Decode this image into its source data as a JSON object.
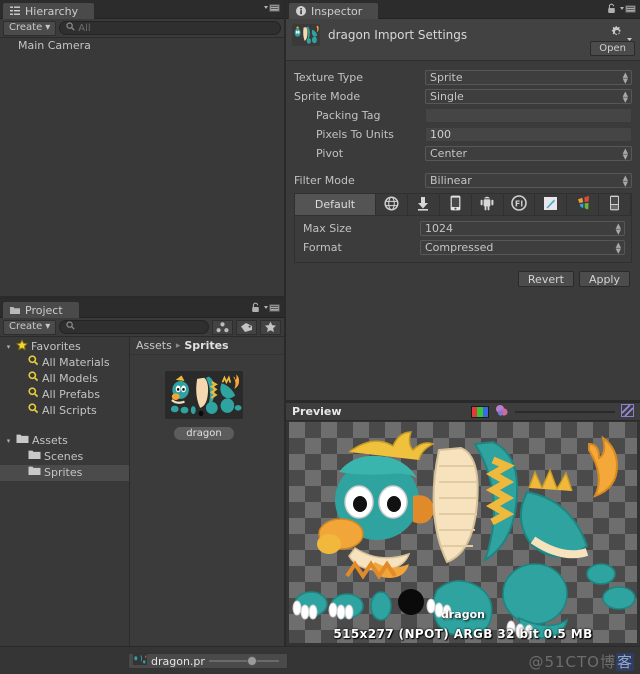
{
  "hierarchy": {
    "tab_label": "Hierarchy",
    "tab_icon": "hierarchy-icon",
    "menu_icon": "panel-menu-icon",
    "create_label": "Create",
    "create_arrow": "▾",
    "search_placeholder": "All",
    "search_value": "",
    "search_icon": "search-icon",
    "items": [
      {
        "label": "Main Camera"
      }
    ]
  },
  "project": {
    "tab_label": "Project",
    "tab_icon": "folder-icon",
    "lock_icon": "lock-icon",
    "menu_icon": "panel-menu-icon",
    "create_label": "Create",
    "create_arrow": "▾",
    "search_placeholder": "",
    "search_value": "",
    "search_icon": "search-icon",
    "toolbar_icons": [
      "filter-by-type-icon",
      "filter-by-label-icon",
      "favorite-star-icon"
    ],
    "tree": [
      {
        "label": "Favorites",
        "icon": "star-icon",
        "depth": 0,
        "twisty": "▾",
        "selected": false
      },
      {
        "label": "All Materials",
        "icon": "search-icon",
        "depth": 1,
        "twisty": "",
        "selected": false
      },
      {
        "label": "All Models",
        "icon": "search-icon",
        "depth": 1,
        "twisty": "",
        "selected": false
      },
      {
        "label": "All Prefabs",
        "icon": "search-icon",
        "depth": 1,
        "twisty": "",
        "selected": false
      },
      {
        "label": "All Scripts",
        "icon": "search-icon",
        "depth": 1,
        "twisty": "",
        "selected": false
      },
      {
        "label": "",
        "icon": "",
        "depth": 0,
        "twisty": "",
        "selected": false
      },
      {
        "label": "Assets",
        "icon": "folder-icon",
        "depth": 0,
        "twisty": "▾",
        "selected": false
      },
      {
        "label": "Scenes",
        "icon": "folder-icon",
        "depth": 1,
        "twisty": "",
        "selected": false
      },
      {
        "label": "Sprites",
        "icon": "folder-icon",
        "depth": 1,
        "twisty": "",
        "selected": true
      }
    ],
    "breadcrumb": {
      "root": "Assets",
      "separator": "▸",
      "current": "Sprites"
    },
    "assets": [
      {
        "name": "dragon",
        "thumb": "dragon-sprite-thumbnail"
      }
    ]
  },
  "inspector": {
    "tab_label": "Inspector",
    "tab_icon": "inspector-icon",
    "lock_icon": "lock-icon",
    "menu_icon": "panel-menu-icon",
    "asset_title": "dragon Import Settings",
    "asset_icon": "dragon-sprite-thumbnail",
    "gear_icon": "gear-icon",
    "open_label": "Open",
    "fields": [
      {
        "label": "Texture Type",
        "value": "Sprite",
        "kind": "popup",
        "indent": false
      },
      {
        "label": "Sprite Mode",
        "value": "Single",
        "kind": "popup",
        "indent": false
      },
      {
        "label": "Packing Tag",
        "value": "",
        "kind": "text",
        "indent": true
      },
      {
        "label": "Pixels To Units",
        "value": "100",
        "kind": "text-plain",
        "indent": true
      },
      {
        "label": "Pivot",
        "value": "Center",
        "kind": "popup",
        "indent": true
      }
    ],
    "filter_mode": {
      "label": "Filter Mode",
      "value": "Bilinear",
      "kind": "popup"
    },
    "platforms": [
      {
        "name": "Default",
        "icon": "default-tab",
        "selected": true
      },
      {
        "name": "Web Player",
        "icon": "web-globe-icon",
        "selected": false
      },
      {
        "name": "Standalone",
        "icon": "standalone-download-icon",
        "selected": false
      },
      {
        "name": "iOS",
        "icon": "ios-phone-icon",
        "selected": false
      },
      {
        "name": "Android",
        "icon": "android-robot-icon",
        "selected": false
      },
      {
        "name": "Flash Player",
        "icon": "flash-player-icon",
        "selected": false
      },
      {
        "name": "Tizen",
        "icon": "tizen-icon",
        "selected": false
      },
      {
        "name": "Windows Store Apps",
        "icon": "windows-store-icon",
        "selected": false
      },
      {
        "name": "BlackBerry",
        "icon": "blackberry-icon",
        "selected": false
      }
    ],
    "platform_fields": [
      {
        "label": "Max Size",
        "value": "1024",
        "kind": "popup"
      },
      {
        "label": "Format",
        "value": "Compressed",
        "kind": "popup"
      }
    ],
    "buttons": {
      "revert": "Revert",
      "apply": "Apply"
    }
  },
  "preview": {
    "title": "Preview",
    "rgb_icon": "rgb-channels-icon",
    "alpha_icon": "alpha-channel-icon",
    "mip_slider_icon": "mip-level-icon",
    "image_label": "dragon",
    "info": "515x277 (NPOT)  ARGB 32 bit  0.5 MB"
  },
  "statusbar": {
    "asset_name": "dragon.pr",
    "asset_icon": "dragon-sprite-thumbnail",
    "zoom_value": "",
    "watermark": "@51CTO",
    "watermark_cn": "博",
    "watermark_hl": "客"
  },
  "colors": {
    "panel_bg": "#3b3b3b",
    "tab_bg": "#4a4a4a",
    "accent_teal": "#2a9d9a",
    "accent_orange": "#f0a33c",
    "selection": "#4b4b4b"
  }
}
